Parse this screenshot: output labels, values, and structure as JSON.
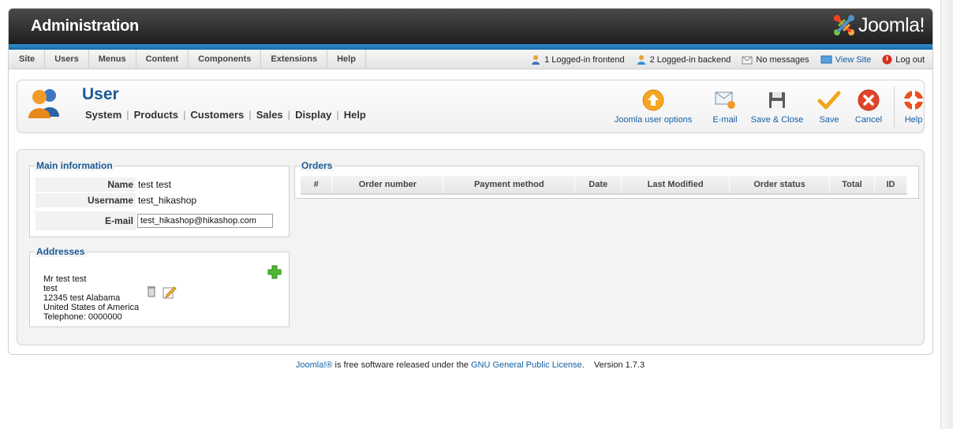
{
  "header": {
    "title": "Administration",
    "logo_text": "Joomla!"
  },
  "menu": {
    "items": [
      "Site",
      "Users",
      "Menus",
      "Content",
      "Components",
      "Extensions",
      "Help"
    ]
  },
  "status": {
    "frontend": "1 Logged-in frontend",
    "backend": "2 Logged-in backend",
    "messages": "No messages",
    "view_site": "View Site",
    "logout": "Log out"
  },
  "page": {
    "title": "User",
    "submenu": [
      "System",
      "Products",
      "Customers",
      "Sales",
      "Display",
      "Help"
    ]
  },
  "toolbar": {
    "user_options": "Joomla user options",
    "email": "E-mail",
    "save_close": "Save & Close",
    "save": "Save",
    "cancel": "Cancel",
    "help": "Help"
  },
  "main_info": {
    "legend": "Main information",
    "name_label": "Name",
    "name_value": "test test",
    "username_label": "Username",
    "username_value": "test_hikashop",
    "email_label": "E-mail",
    "email_value": "test_hikashop@hikashop.com"
  },
  "addresses": {
    "legend": "Addresses",
    "lines": [
      "Mr test test",
      "test",
      "12345 test Alabama",
      "United States of America",
      "Telephone: 0000000"
    ]
  },
  "orders": {
    "legend": "Orders",
    "columns": [
      "#",
      "Order number",
      "Payment method",
      "Date",
      "Last Modified",
      "Order status",
      "Total",
      "ID"
    ]
  },
  "footer": {
    "joomla": "Joomla!®",
    "text": " is free software released under the ",
    "license": "GNU General Public License",
    "version": ".    Version 1.7.3"
  },
  "colors": {
    "accent_blue": "#1a5a96",
    "link_blue": "#1560a5",
    "header_dark": "#1e1e1e",
    "stripe_blue": "#2f8fd0",
    "save_orange": "#f2a51c",
    "cancel_red": "#e0442a",
    "add_green": "#4cb82f"
  }
}
